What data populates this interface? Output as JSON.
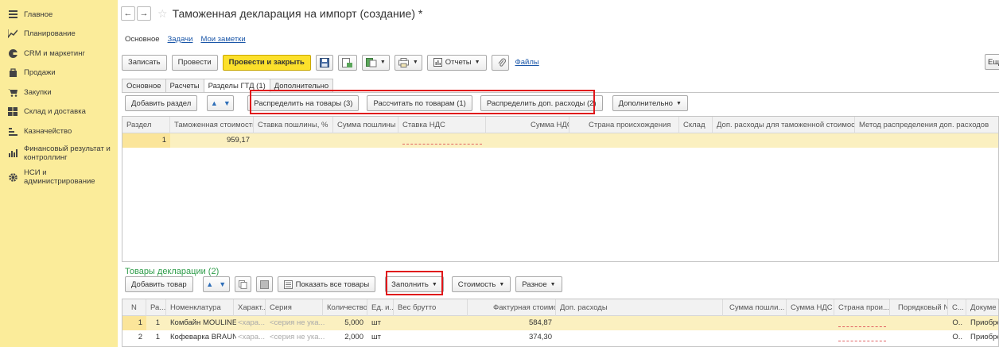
{
  "sidebar": {
    "items": [
      {
        "label": "Главное",
        "icon": "menu-icon"
      },
      {
        "label": "Планирование",
        "icon": "chart-icon"
      },
      {
        "label": "CRM и маркетинг",
        "icon": "crm-icon"
      },
      {
        "label": "Продажи",
        "icon": "bag-icon"
      },
      {
        "label": "Закупки",
        "icon": "cart-icon"
      },
      {
        "label": "Склад и доставка",
        "icon": "warehouse-icon"
      },
      {
        "label": "Казначейство",
        "icon": "treasury-icon"
      },
      {
        "label": "Финансовый результат и контроллинг",
        "icon": "finance-icon"
      },
      {
        "label": "НСИ и администрирование",
        "icon": "gear-icon"
      }
    ]
  },
  "header": {
    "back": "←",
    "forward": "→",
    "star": "☆",
    "title": "Таможенная декларация на импорт (создание) *",
    "subnav": {
      "current": "Основное",
      "tasks": "Задачи",
      "notes": "Мои заметки"
    }
  },
  "toolbar": {
    "save": "Записать",
    "post": "Провести",
    "post_close": "Провести и закрыть",
    "reports": "Отчеты",
    "files": "Файлы",
    "more": "Еще"
  },
  "tabs": [
    "Основное",
    "Расчеты",
    "Разделы ГТД (1)",
    "Дополнительно"
  ],
  "sections_toolbar": {
    "add": "Добавить раздел",
    "distribute_goods": "Распределить на товары (3)",
    "calc_goods": "Рассчитать по товарам (1)",
    "distribute_extra": "Распределить доп. расходы (2)",
    "additional": "Дополнительно"
  },
  "sections_table": {
    "columns": [
      "Раздел",
      "Таможенная стоимость",
      "Ставка пошлины, %",
      "Сумма пошлины",
      "Ставка НДС",
      "Сумма НДС",
      "Страна происхождения",
      "Склад",
      "Доп. расходы для таможенной стоимости",
      "Метод распределения доп. расходов"
    ],
    "rows": [
      {
        "section": "1",
        "customs_value": "959,17"
      }
    ]
  },
  "goods": {
    "title": "Товары декларации (2)",
    "toolbar": {
      "add": "Добавить товар",
      "show_all": "Показать все товары",
      "fill": "Заполнить",
      "cost": "Стоимость",
      "misc": "Разное"
    },
    "columns": [
      "N",
      "Ра...",
      "Номенклатура",
      "Характ...",
      "Серия",
      "Количество",
      "Ед. и...",
      "Вес брутто",
      "Фактурная стоимость",
      "Доп. расходы",
      "Сумма пошли...",
      "Сумма НДС",
      "Страна прои...",
      "Порядковый №",
      "С...",
      "Докуме"
    ],
    "rows": [
      {
        "n": "1",
        "section": "1",
        "item": "Комбайн MOULINEX...",
        "char": "<хара...",
        "series": "<серия не ука...",
        "qty": "5,000",
        "unit": "шт",
        "invoice": "584,87",
        "s": "О..",
        "doc": "Приобре"
      },
      {
        "n": "2",
        "section": "1",
        "item": "Кофеварка BRAUN ...",
        "char": "<хара...",
        "series": "<серия не ука...",
        "qty": "2,000",
        "unit": "шт",
        "invoice": "374,30",
        "s": "О..",
        "doc": "Приобре"
      }
    ]
  },
  "colors": {
    "sidebar": "#fbec9a",
    "primary_button": "#fce02b",
    "highlight_red": "#e0161a",
    "section_green": "#2e9c49"
  }
}
